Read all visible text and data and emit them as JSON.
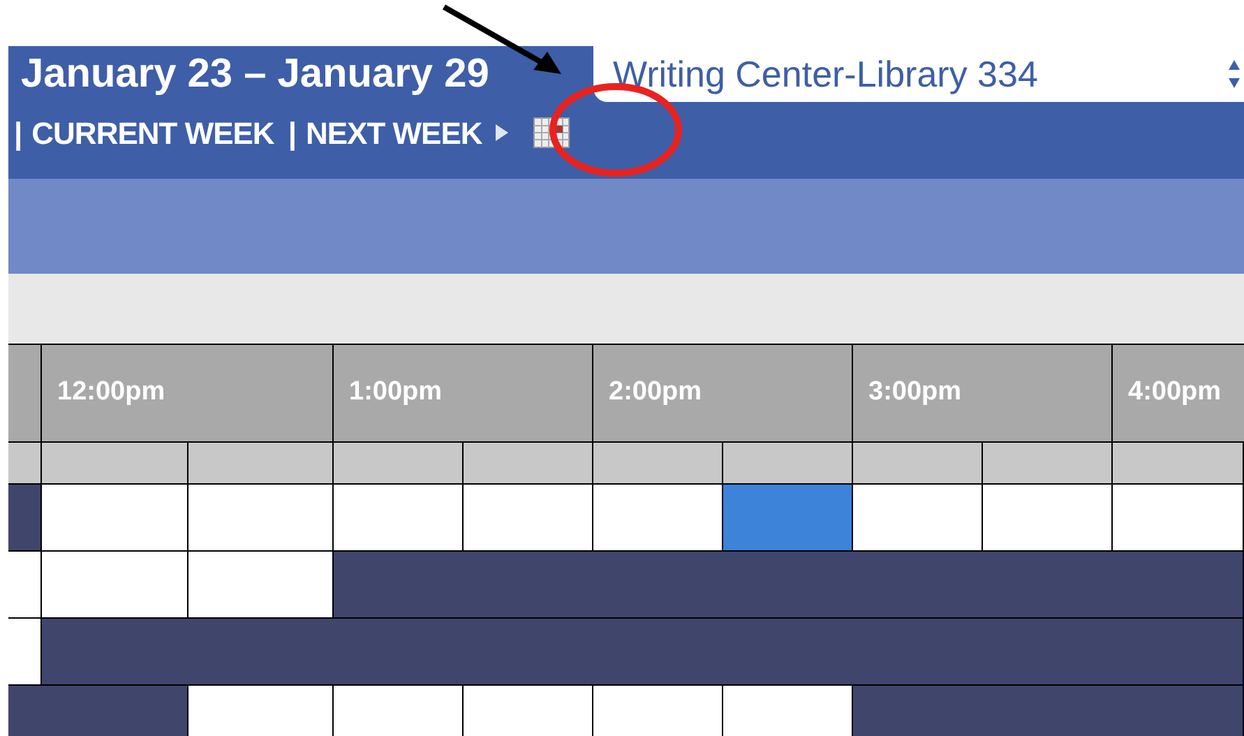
{
  "header": {
    "title": "January 23 – January 29",
    "nav": [
      {
        "kind": "separator",
        "label": "|"
      },
      {
        "kind": "link",
        "label": "CURRENT WEEK"
      },
      {
        "kind": "separator",
        "label": "|"
      },
      {
        "kind": "link",
        "label": "NEXT WEEK"
      }
    ],
    "location": {
      "value": "Writing Center-Library 334"
    }
  },
  "schedule": {
    "hours": [
      "12:00pm",
      "1:00pm",
      "2:00pm",
      "3:00pm",
      "4:00pm"
    ],
    "rows": [
      {
        "cells": [
          {
            "kind": "booked"
          },
          {
            "kind": "open"
          },
          {
            "kind": "open"
          },
          {
            "kind": "open"
          },
          {
            "kind": "open"
          },
          {
            "kind": "open"
          },
          {
            "kind": "selected"
          },
          {
            "kind": "open"
          },
          {
            "kind": "open"
          },
          {
            "kind": "open"
          }
        ]
      },
      {
        "cells": [
          {
            "kind": "open"
          },
          {
            "kind": "open"
          },
          {
            "kind": "open"
          },
          {
            "kind": "booked"
          },
          {
            "kind": "booked"
          },
          {
            "kind": "booked"
          },
          {
            "kind": "booked"
          },
          {
            "kind": "booked"
          },
          {
            "kind": "booked"
          },
          {
            "kind": "booked"
          }
        ]
      },
      {
        "cells": [
          {
            "kind": "open"
          },
          {
            "kind": "booked"
          },
          {
            "kind": "booked"
          },
          {
            "kind": "booked"
          },
          {
            "kind": "booked"
          },
          {
            "kind": "booked"
          },
          {
            "kind": "booked"
          },
          {
            "kind": "booked"
          },
          {
            "kind": "booked"
          },
          {
            "kind": "booked"
          }
        ]
      },
      {
        "cells": [
          {
            "kind": "booked"
          },
          {
            "kind": "booked"
          },
          {
            "kind": "open"
          },
          {
            "kind": "open"
          },
          {
            "kind": "open"
          },
          {
            "kind": "open"
          },
          {
            "kind": "open"
          },
          {
            "kind": "booked"
          },
          {
            "kind": "booked"
          },
          {
            "kind": "booked"
          }
        ]
      }
    ]
  }
}
